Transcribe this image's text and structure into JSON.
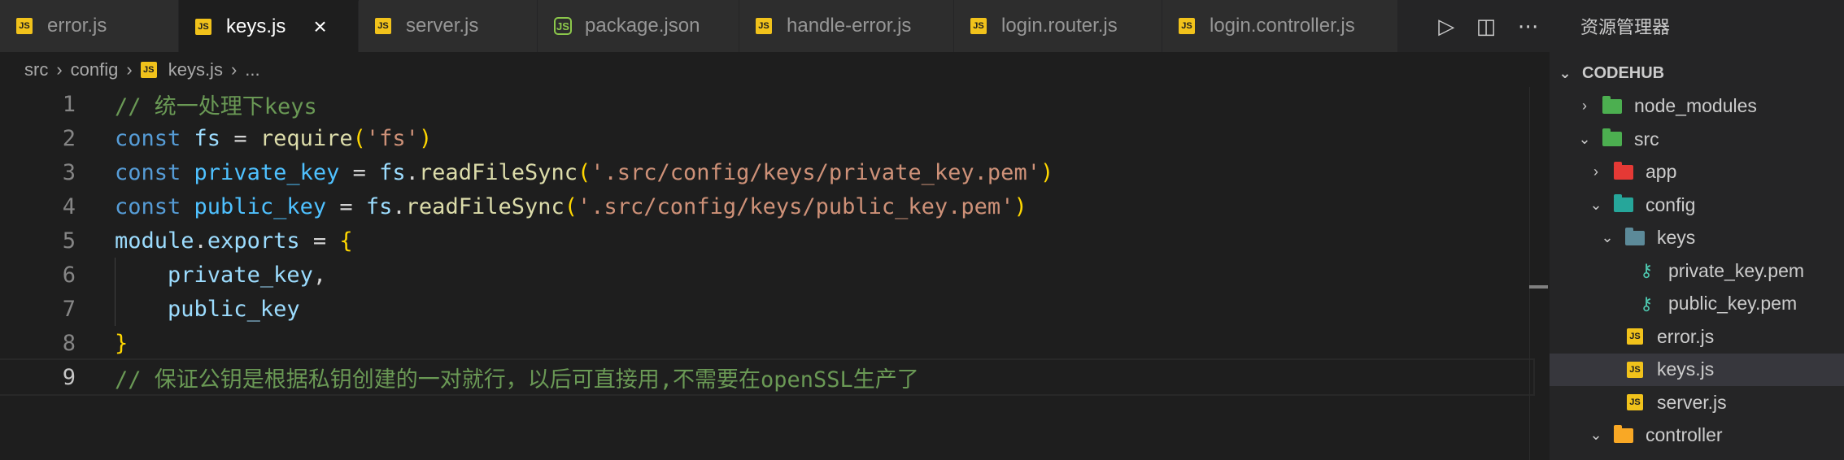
{
  "tabs": [
    {
      "label": "error.js",
      "type": "js",
      "active": false
    },
    {
      "label": "keys.js",
      "type": "js",
      "active": true
    },
    {
      "label": "server.js",
      "type": "js",
      "active": false
    },
    {
      "label": "package.json",
      "type": "node",
      "active": false
    },
    {
      "label": "handle-error.js",
      "type": "js",
      "active": false
    },
    {
      "label": "login.router.js",
      "type": "js",
      "active": false
    },
    {
      "label": "login.controller.js",
      "type": "js",
      "active": false
    }
  ],
  "tab_actions": {
    "run": "▷",
    "split": "◫",
    "more": "⋯"
  },
  "breadcrumb": {
    "part1": "src",
    "part2": "config",
    "file": "keys.js",
    "ellipsis": "..."
  },
  "code": {
    "line_numbers": [
      "1",
      "2",
      "3",
      "4",
      "5",
      "6",
      "7",
      "8",
      "9"
    ],
    "l1": "// 统一处理下keys",
    "l2_kw": "const",
    "l2_var": "fs",
    "l2_op": " = ",
    "l2_fn": "require",
    "l2_str": "'fs'",
    "l3_kw": "const",
    "l3_var": "private_key",
    "l3_obj": "fs",
    "l3_fn": "readFileSync",
    "l3_str": "'.src/config/keys/private_key.pem'",
    "l4_kw": "const",
    "l4_var": "public_key",
    "l4_obj": "fs",
    "l4_fn": "readFileSync",
    "l4_str": "'.src/config/keys/public_key.pem'",
    "l5_mod": "module",
    "l5_exp": "exports",
    "l6": "private_key",
    "l7": "public_key",
    "l9": "// 保证公钥是根据私钥创建的一对就行，以后可直接用,不需要在openSSL生产了"
  },
  "explorer": {
    "title": "资源管理器",
    "root": "CODEHUB",
    "items": [
      {
        "label": "node_modules",
        "indent": 1,
        "chevron": "closed",
        "icon": "folder-green"
      },
      {
        "label": "src",
        "indent": 1,
        "chevron": "open",
        "icon": "folder-green"
      },
      {
        "label": "app",
        "indent": 2,
        "chevron": "closed",
        "icon": "folder-red"
      },
      {
        "label": "config",
        "indent": 2,
        "chevron": "open",
        "icon": "folder-teal"
      },
      {
        "label": "keys",
        "indent": 3,
        "chevron": "open",
        "icon": "folder-slate"
      },
      {
        "label": "private_key.pem",
        "indent": 4,
        "chevron": "none",
        "icon": "key"
      },
      {
        "label": "public_key.pem",
        "indent": 4,
        "chevron": "none",
        "icon": "key"
      },
      {
        "label": "error.js",
        "indent": 3,
        "chevron": "none",
        "icon": "js"
      },
      {
        "label": "keys.js",
        "indent": 3,
        "chevron": "none",
        "icon": "js",
        "selected": true
      },
      {
        "label": "server.js",
        "indent": 3,
        "chevron": "none",
        "icon": "js"
      },
      {
        "label": "controller",
        "indent": 2,
        "chevron": "open",
        "icon": "folder-yellow"
      }
    ]
  }
}
